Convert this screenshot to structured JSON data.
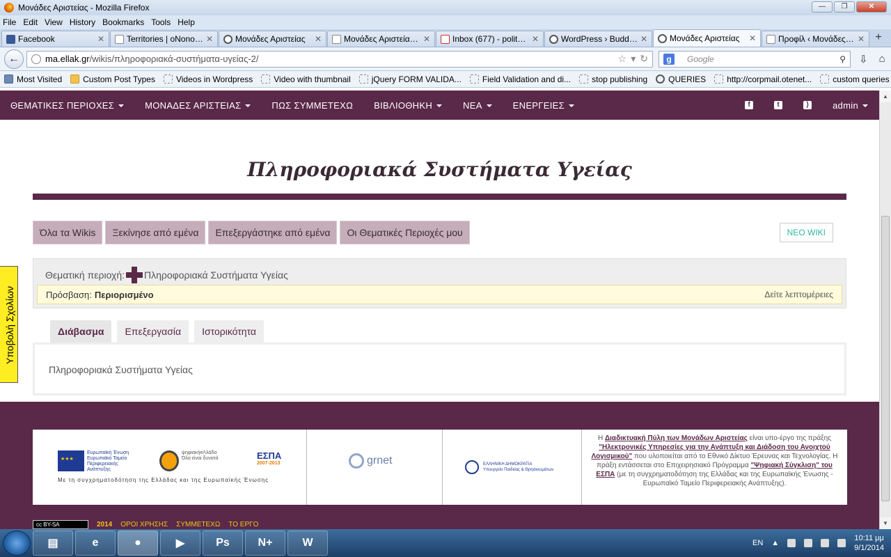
{
  "window": {
    "title": "Μονάδες Αριστείας - Mozilla Firefox"
  },
  "menu": [
    "File",
    "Edit",
    "View",
    "History",
    "Bookmarks",
    "Tools",
    "Help"
  ],
  "tabs": [
    {
      "label": "Facebook",
      "icon": "facebook-icon"
    },
    {
      "label": "Territories | oNonos...",
      "icon": "page-icon"
    },
    {
      "label": "Μονάδες Αριστείας",
      "icon": "wordpress-icon"
    },
    {
      "label": "Μονάδες Αριστείας...",
      "icon": "page-icon"
    },
    {
      "label": "Inbox (677) - polito...",
      "icon": "gmail-icon"
    },
    {
      "label": "WordPress › Buddy...",
      "icon": "wordpress-icon"
    },
    {
      "label": "Μονάδες Αριστείας",
      "icon": "wordpress-icon",
      "active": true
    },
    {
      "label": "Προφίλ ‹ Μονάδες ...",
      "icon": "page-icon"
    }
  ],
  "url": {
    "host": "ma.ellak.gr",
    "path": "/wikis/πληροφοριακά-συστήματα-υγείας-2/"
  },
  "search": {
    "placeholder": "Google"
  },
  "bookmarks": [
    "Most Visited",
    "Custom Post Types",
    "Videos in Wordpress",
    "Video with thumbnail",
    "jQuery FORM VALIDA...",
    "Field Validation and di...",
    "stop publishing",
    "QUERIES",
    "http://corpmail.otenet...",
    "custom queries"
  ],
  "sitenav": {
    "items": [
      {
        "label": "ΘΕΜΑΤΙΚΕΣ ΠΕΡΙΟΧΕΣ",
        "caret": true
      },
      {
        "label": "ΜΟΝΑΔΕΣ ΑΡΙΣΤΕΙΑΣ",
        "caret": true
      },
      {
        "label": "ΠΩΣ ΣΥΜΜΕΤΕΧΩ",
        "caret": false
      },
      {
        "label": "ΒΙΒΛΙΟΘΗΚΗ",
        "caret": true
      },
      {
        "label": "ΝΕΑ",
        "caret": true
      },
      {
        "label": "ΕΝΕΡΓΕΙΕΣ",
        "caret": true
      }
    ],
    "user": "admin"
  },
  "page": {
    "title": "Πληροφοριακά Συστήματα Υγείας",
    "wiki_tabs": [
      "Όλα τα Wikis",
      "Ξεκίνησε από εμένα",
      "Επεξεργάστηκε από εμένα",
      "Οι Θεματικές Περιοχές μου"
    ],
    "new_wiki": "ΝΕΟ WIKI",
    "category_label": "Θεματική περιοχή:",
    "category_value": "Πληροφοριακά Συστήματα Υγείας",
    "access_label": "Πρόσβαση:",
    "access_value": "Περιορισμένο",
    "details_link": "Δείτε λεπτομέρειες",
    "read_tabs": [
      "Διάβασμα",
      "Επεξεργασία",
      "Ιστορικότητα"
    ],
    "content": "Πληροφοριακά Συστήματα Υγείας"
  },
  "sidetab": "Υποβολή Σχολίων",
  "footer": {
    "eu_text": [
      "Ευρωπαϊκή Ένωση",
      "Ευρωπαϊκό Ταμείο",
      "Περιφερειακής",
      "Ανάπτυξης"
    ],
    "digital_text": [
      "ψηφιακήeΛλάδα",
      "Όλα είναι δυνατά"
    ],
    "espa": "ΕΣΠΑ",
    "espa_years": "2007-2013",
    "caption": "Με τη συγχρηματοδότηση της Ελλάδας και της Ευρωπαϊκής Ένωσης",
    "grnet": "grnet",
    "ministry": [
      "ΕΛΛΗΝΙΚΗ ΔΗΜΟΚΡΑΤΙΑ",
      "Υπουργείο Παιδείας & Θρησκευμάτων"
    ],
    "desc_1": "Η ",
    "desc_link1": "Διαδικτυακή Πύλη των Μονάδων Αριστείας",
    "desc_2": " είναι υπο-έργο της πράξης ",
    "desc_link2": "\"Ηλεκτρονικές Υπηρεσίες για την Ανάπτυξη και Διάδοση του Ανοιχτού Λογισμικού\"",
    "desc_3": " που υλοποιείται από το Εθνικό Δίκτυο Έρευνας και Τεχνολογίας. Η πράξη εντάσσεται στο Επιχειρησιακό Πρόγραμμα ",
    "desc_link3": "\"Ψηφιακή Σύγκλιση\" του ΕΣΠΑ",
    "desc_4": " (με τη συγχρηματοδότηση της Ελλάδας και της Ευρωπαϊκής Ένωσης - Ευρωπαϊκό Ταμείο Περιφερειακής Ανάπτυξης).",
    "license": "BY-SA",
    "year": "2014",
    "links": [
      "ΟΡΟΙ ΧΡΗΣΗΣ",
      "ΣΥΜΜΕΤΕΧΩ",
      "ΤΟ ΕΡΓΟ"
    ]
  },
  "taskbar": {
    "apps": [
      {
        "name": "explorer",
        "glyph": "▤"
      },
      {
        "name": "internet-explorer",
        "glyph": "e"
      },
      {
        "name": "firefox",
        "glyph": "●"
      },
      {
        "name": "media-player",
        "glyph": "▶"
      },
      {
        "name": "photoshop",
        "glyph": "Ps"
      },
      {
        "name": "notepad-plus",
        "glyph": "N+"
      },
      {
        "name": "word",
        "glyph": "W"
      }
    ],
    "lang": "EN",
    "time": "10:11 μμ",
    "date": "9/1/2014"
  }
}
